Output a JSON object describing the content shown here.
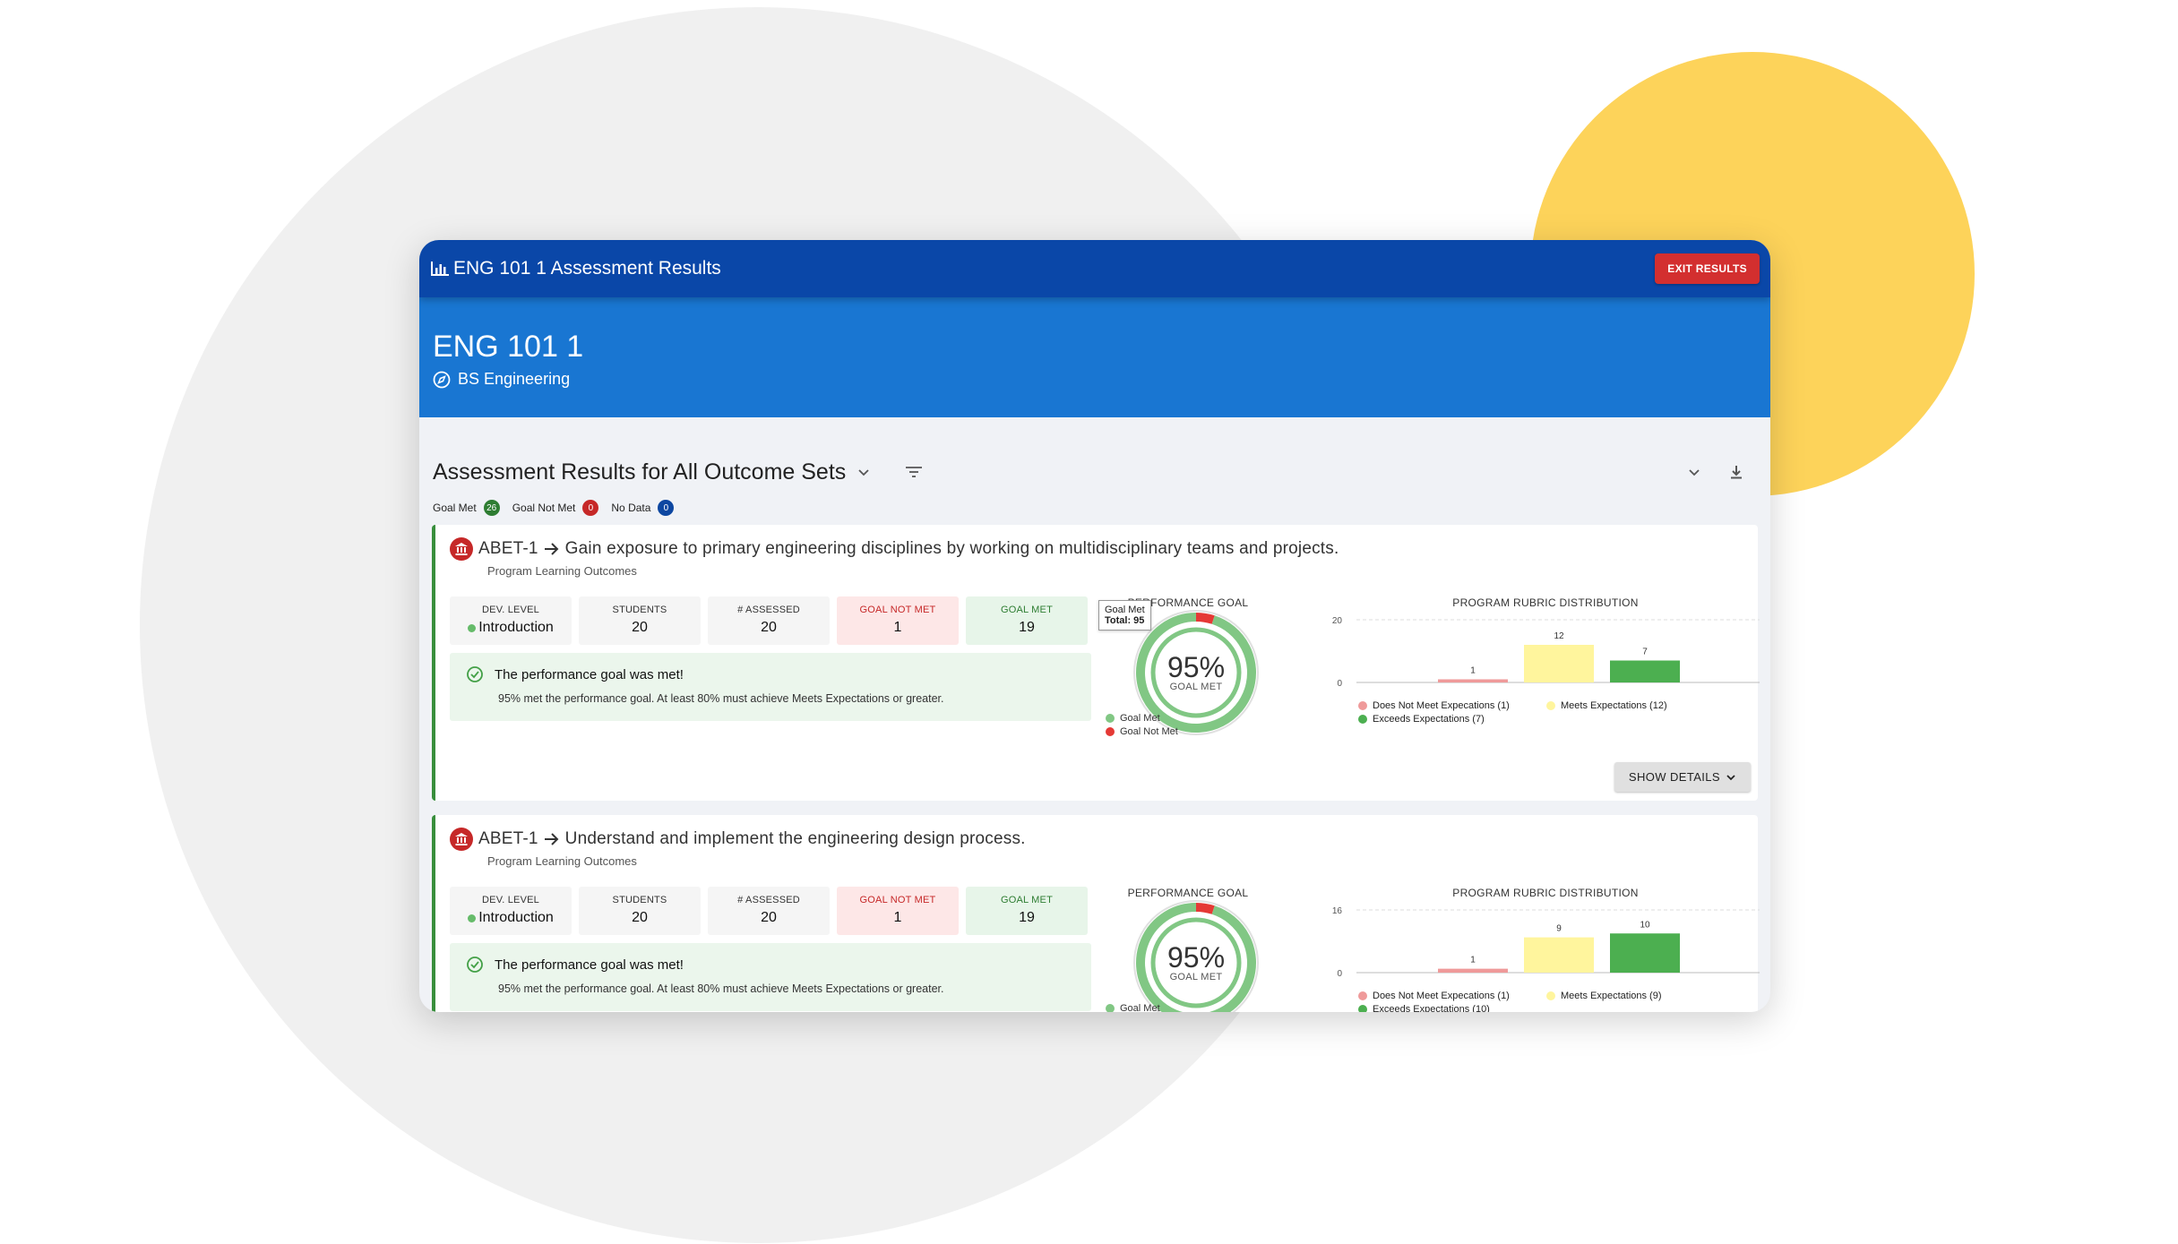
{
  "window_title": "ENG 101 1 Assessment Results",
  "exit_label": "EXIT RESULTS",
  "course": "ENG 101 1",
  "program": "BS Engineering",
  "section_title": "Assessment Results for All Outcome Sets",
  "summary": {
    "goal_met_label": "Goal Met",
    "goal_met_count": "26",
    "goal_not_met_label": "Goal Not Met",
    "goal_not_met_count": "0",
    "no_data_label": "No Data",
    "no_data_count": "0"
  },
  "colors": {
    "topbar": "#0a47a8",
    "hero": "#1976d2",
    "goal_met": "#81c784",
    "goal_not_met": "#e53935",
    "meets": "#fff59d",
    "exceeds": "#4caf50",
    "does_not_meet": "#ef9a9a"
  },
  "outcomes": [
    {
      "code": "ABET-1",
      "title": "Gain exposure to primary engineering disciplines by working on multidisciplinary teams and projects.",
      "subtitle": "Program Learning Outcomes",
      "stats": [
        {
          "label": "DEV. LEVEL",
          "value": "Introduction"
        },
        {
          "label": "STUDENTS",
          "value": "20"
        },
        {
          "label": "# ASSESSED",
          "value": "20"
        },
        {
          "label": "GOAL NOT MET",
          "value": "1"
        },
        {
          "label": "GOAL MET",
          "value": "19"
        }
      ],
      "goal_title": "The performance goal was met!",
      "goal_desc": "95% met the performance goal. At least 80% must achieve Meets Expectations or greater.",
      "perf_title": "PERFORMANCE GOAL",
      "perf_pct": "95%",
      "perf_label": "GOAL MET",
      "perf_fraction": 0.95,
      "tooltip_label": "Goal Met",
      "tooltip_total": "Total: 95",
      "legend_met": "Goal Met",
      "legend_not_met": "Goal Not Met",
      "show_details": "SHOW DETAILS",
      "chart_data": {
        "type": "bar",
        "title": "PROGRAM RUBRIC DISTRIBUTION",
        "categories": [
          "Does Not Meet Expecations",
          "Meets Expectations",
          "Exceeds Expectations"
        ],
        "values": [
          1,
          12,
          7
        ],
        "ylim": [
          0,
          20
        ],
        "yticks": [
          "20",
          "0"
        ],
        "legend": [
          "Does Not Meet Expecations (1)",
          "Meets Expectations (12)",
          "Exceeds Expectations (7)"
        ]
      }
    },
    {
      "code": "ABET-1",
      "title": "Understand and implement the engineering design process.",
      "subtitle": "Program Learning Outcomes",
      "stats": [
        {
          "label": "DEV. LEVEL",
          "value": "Introduction"
        },
        {
          "label": "STUDENTS",
          "value": "20"
        },
        {
          "label": "# ASSESSED",
          "value": "20"
        },
        {
          "label": "GOAL NOT MET",
          "value": "1"
        },
        {
          "label": "GOAL MET",
          "value": "19"
        }
      ],
      "goal_title": "The performance goal was met!",
      "goal_desc": "95% met the performance goal. At least 80% must achieve Meets Expectations or greater.",
      "perf_title": "PERFORMANCE GOAL",
      "perf_pct": "95%",
      "perf_label": "GOAL MET",
      "perf_fraction": 0.95,
      "legend_met": "Goal Met",
      "chart_data": {
        "type": "bar",
        "title": "PROGRAM RUBRIC DISTRIBUTION",
        "categories": [
          "Does Not Meet Expecations",
          "Meets Expectations",
          "Exceeds Expectations"
        ],
        "values": [
          1,
          9,
          10
        ],
        "ylim": [
          0,
          16
        ],
        "yticks": [
          "16",
          "0"
        ],
        "legend": [
          "Does Not Meet Expecations (1)",
          "Meets Expectations (9)",
          "Exceeds Expectations (10)"
        ]
      }
    }
  ]
}
